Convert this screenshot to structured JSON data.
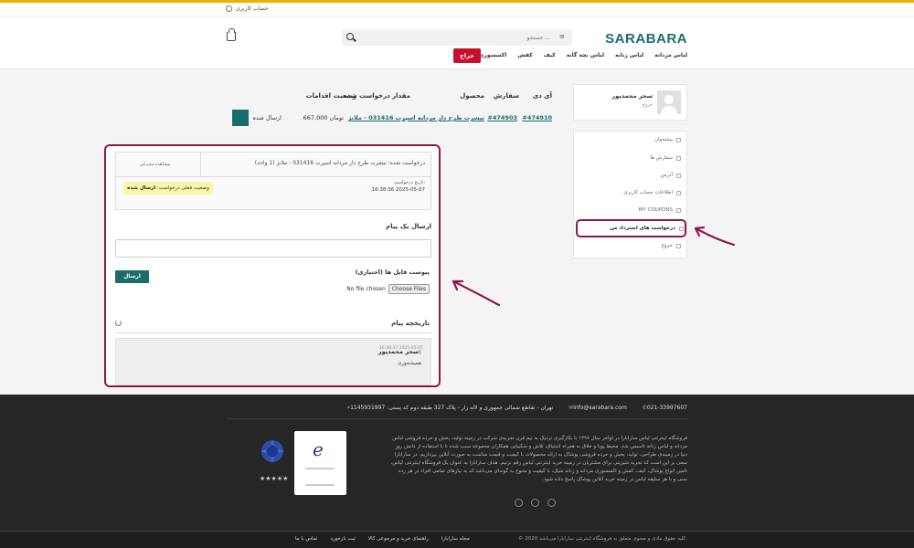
{
  "topbar": {
    "account_label": "حساب کاربری"
  },
  "header": {
    "logo": "SARABARA",
    "search_placeholder": "جستجو ...",
    "menu": [
      "لباس مردانه",
      "لباس زنانه",
      "لباس بچه گانه",
      "کیف",
      "کفش",
      "اکسسوری"
    ],
    "exit_button": "خراج"
  },
  "profile": {
    "name": "سحر محمدپور",
    "sub": "خروج"
  },
  "sidebar": {
    "items": [
      {
        "label": "پیشخوان"
      },
      {
        "label": "سفارش ها"
      },
      {
        "label": "آدرس"
      },
      {
        "label": "اطلاعات حساب کاربری"
      },
      {
        "label": "MY COUPONS"
      },
      {
        "label": "درخواست های استرداد من"
      },
      {
        "label": "خروج"
      }
    ]
  },
  "orders_table": {
    "headers": {
      "id": "آی دی",
      "order": "سفارش",
      "product": "محصول",
      "amount": "مقدار درخواست شده",
      "status": "وضعیت",
      "actions": "اقدامات"
    },
    "row": {
      "id": "#474910",
      "order": "#474903",
      "product": "تیشرت طرح دار مردانه اسپرت 031416 - ملانژ",
      "amount": "667,000 تومان",
      "status": "ارسال شده"
    }
  },
  "request_panel": {
    "title": "درخواست شده: تیشرت طرح دار مردانه اسپرت 031416 - ملانژ (1 واحد)",
    "side_label": "مشاهده محرکی",
    "date_label": "تاریخ درخواست:",
    "date_value": "16:38:36 2025-05-07",
    "status_prefix": "وضعیت فعلی درخواست:",
    "status_value": "ارسال شده",
    "send_message_label": "ارسال یک پیام",
    "attach_label": "پیوست فایل ها (اختیاری)",
    "send_button": "ارسال",
    "file_status": "No file chosen",
    "choose_button": "Choose Files",
    "history_label": "تاریخچه پیام",
    "message": {
      "time": "16:38:37 2025-05-07",
      "author": "سحر محمدپور:",
      "text": "همیشجوری"
    }
  },
  "footer": {
    "phone": "021-33997607",
    "email": "info@sarabara.com",
    "address": "تهران - تقاطع شمالی جمهوری و لاله زار - پلاک 327 طبقه دوم کد پستی: 1145931997",
    "about": "فروشگاه اینترنتی لباس سارابارا در اواخر سال ۱۳۹۶ با بکارگیری نزدیک به نیم قرن تجربه‌ی شرکت در زمینه تولید، پخش و خرده فروشی لباس مردانه و لباس زنانه تاسیس شد. محیط پویا و خلاق به همراه اشتیاق، تلاش و شکیبایی همکاران مجموعه سبب شده تا با استفاده از دانش روز دنیا در زمینه‌ی طراحی، تولید، پخش و خرده فروشی پوشاک به ارائه محصولات با کیفیت و قیمت مناسب به صورت آنلاین بپردازیم. در سارابارا سعی بر این است که تجربه شیرینی برای مشتریان در زمینه خرید اینترنتی لباس رقم بزنیم. هدف سارابارا به عنوان یک فروشگاه اینترنتی لباس، تامین انواع پوشاک، کیف، کفش و اکسسوری مردانه و زنانه شیک، با کیفیت و متنوع به گونه‌ای می‌باشد که به نیازهای تمامی افراد در هر رده سنی و با هر سلیقه لباس در زمینه خرید آنلاین پوشاک پاسخ داده شود.",
    "stars": "★★★★★",
    "copyright": "© 2020 کلیه حقوق مادی و معنوی متعلق به فروشگاه اینترنتی سارابارا می‌باشد.",
    "links": [
      "مجله سارابارا",
      "راهنمای خرید و مرجوعی کالا",
      "ثبت بازخورد",
      "تماس با ما"
    ]
  },
  "colors": {
    "brand": "#1b6d6c",
    "accent": "#c8102e",
    "highlight": "#8e1749"
  }
}
